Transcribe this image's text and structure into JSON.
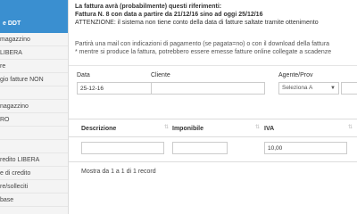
{
  "sidebar": {
    "header": "e DDT",
    "items": [
      "magazzino",
      "LIBERA",
      "re",
      "gio fatture NON",
      "",
      "nagazzino",
      "RO",
      "",
      "",
      "redito LIBERA",
      "e di credito",
      "re/solleciti",
      "base"
    ]
  },
  "notice": {
    "title": "La fattura avrà (probabilmente) questi riferimenti:",
    "line2": "Fattura N. 8 con data a partire da 21/12/16 sino ad oggi 25/12/16",
    "line3": "ATTENZIONE: il sistema non tiene conto della data di fatture saltate tramite ottenimento"
  },
  "info": {
    "line1": "Partirà una mail con indicazioni di pagamento (se pagata=no) o con il download della fattura",
    "line2": "* mentre si produce la fattura, potrebbero essere emesse fatture online collegate a scadenze"
  },
  "form": {
    "data_label": "Data",
    "data_value": "25-12-16",
    "cliente_label": "Cliente",
    "cliente_value": "",
    "agente_label": "Agente/Prov",
    "agente_value": "Seleziona A"
  },
  "table": {
    "columns": [
      "Descrizione",
      "Imponibile",
      "IVA"
    ],
    "row": {
      "descrizione": "",
      "imponibile": "",
      "iva": "10,00"
    },
    "footer": "Mostra da 1 a 1 di 1 record"
  },
  "icons": {
    "calendar": "calendar-icon",
    "sort": "sort-icon",
    "chevron": "chevron-down-icon"
  },
  "colors": {
    "sidebar_active": "#3a8fd0"
  }
}
